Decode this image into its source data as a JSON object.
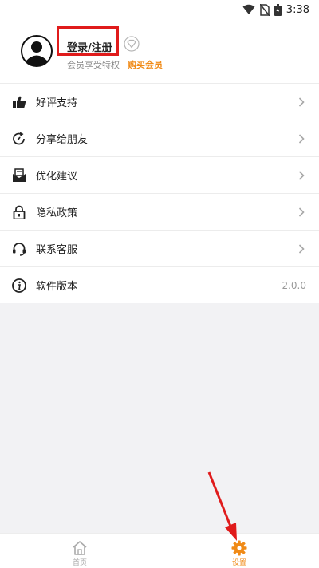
{
  "status_bar": {
    "time": "3:38"
  },
  "profile": {
    "login_label": "登录/注册",
    "member_text": "会员享受特权",
    "buy_member_label": "购买会员"
  },
  "menu": {
    "items": [
      {
        "label": "好评支持",
        "icon": "thumbs-up-icon"
      },
      {
        "label": "分享给朋友",
        "icon": "share-refresh-icon"
      },
      {
        "label": "优化建议",
        "icon": "envelope-icon"
      },
      {
        "label": "隐私政策",
        "icon": "lock-icon"
      },
      {
        "label": "联系客服",
        "icon": "headset-icon"
      },
      {
        "label": "软件版本",
        "icon": "info-icon",
        "value": "2.0.0"
      }
    ]
  },
  "tabbar": {
    "tabs": [
      {
        "label": "首页",
        "icon": "home-icon",
        "active": false
      },
      {
        "label": "设置",
        "icon": "gear-icon",
        "active": true
      }
    ]
  },
  "colors": {
    "accent": "#f08a16",
    "highlight": "#e01b1b"
  }
}
